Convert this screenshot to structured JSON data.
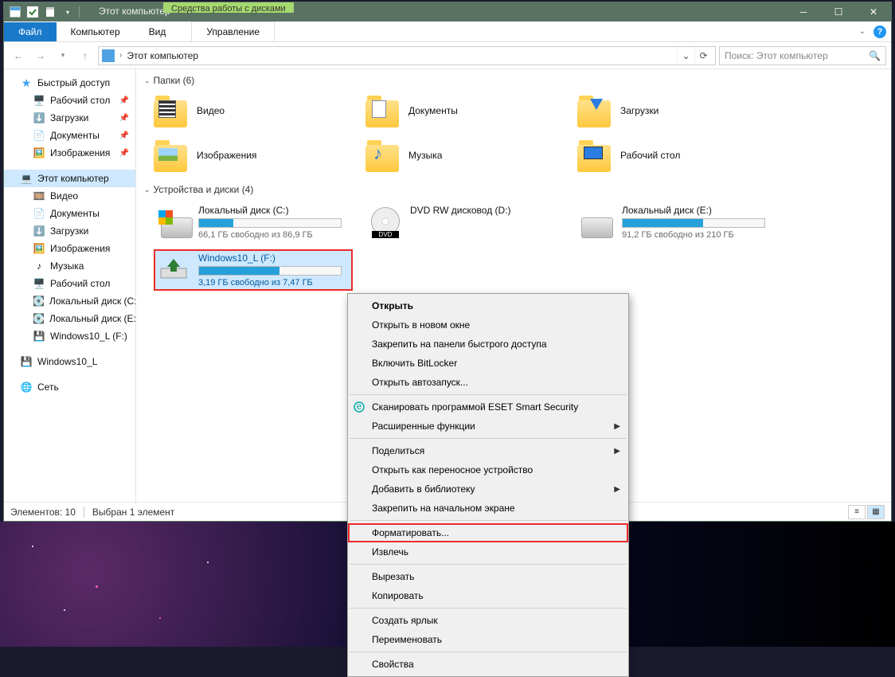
{
  "titlebar": {
    "context_label": "Средства работы с дисками",
    "context_tab": "Управление",
    "title": "Этот компьютер"
  },
  "menu": {
    "file": "Файл",
    "items": [
      "Компьютер",
      "Вид"
    ],
    "manage": "Управление"
  },
  "address": {
    "location": "Этот компьютер"
  },
  "search": {
    "placeholder": "Поиск: Этот компьютер"
  },
  "sidebar": {
    "quick_access": "Быстрый доступ",
    "quick_items": [
      {
        "label": "Рабочий стол",
        "pin": true
      },
      {
        "label": "Загрузки",
        "pin": true
      },
      {
        "label": "Документы",
        "pin": true
      },
      {
        "label": "Изображения",
        "pin": true
      }
    ],
    "this_pc": "Этот компьютер",
    "pc_items": [
      "Видео",
      "Документы",
      "Загрузки",
      "Изображения",
      "Музыка",
      "Рабочий стол",
      "Локальный диск (C:)",
      "Локальный диск (E:)",
      "Windows10_L (F:)"
    ],
    "w10l": "Windows10_L",
    "network": "Сеть"
  },
  "groups": {
    "folders": {
      "header": "Папки (6)",
      "items": [
        "Видео",
        "Документы",
        "Загрузки",
        "Изображения",
        "Музыка",
        "Рабочий стол"
      ]
    },
    "devices": {
      "header": "Устройства и диски (4)",
      "items": [
        {
          "name": "Локальный диск (C:)",
          "free": "66,1 ГБ свободно из 86,9 ГБ",
          "fill": 24,
          "icon": "win"
        },
        {
          "name": "DVD RW дисковод (D:)",
          "free": "",
          "fill": -1,
          "icon": "dvd"
        },
        {
          "name": "Локальный диск (E:)",
          "free": "91,2 ГБ свободно из 210 ГБ",
          "fill": 57,
          "icon": "hdd"
        },
        {
          "name": "Windows10_L (F:)",
          "free": "3,19 ГБ свободно из 7,47 ГБ",
          "fill": 57,
          "icon": "usb",
          "selected": true,
          "highlight": true
        }
      ]
    }
  },
  "status": {
    "count": "Элементов: 10",
    "sel": "Выбран 1 элемент"
  },
  "context_menu": [
    {
      "label": "Открыть",
      "bold": true
    },
    {
      "label": "Открыть в новом окне"
    },
    {
      "label": "Закрепить на панели быстрого доступа"
    },
    {
      "label": "Включить BitLocker"
    },
    {
      "label": "Открыть автозапуск..."
    },
    {
      "sep": true
    },
    {
      "label": "Сканировать программой ESET Smart Security",
      "icon": "eset"
    },
    {
      "label": "Расширенные функции",
      "submenu": true
    },
    {
      "sep": true
    },
    {
      "label": "Поделиться",
      "submenu": true
    },
    {
      "label": "Открыть как переносное устройство"
    },
    {
      "label": "Добавить в библиотеку",
      "submenu": true
    },
    {
      "label": "Закрепить на начальном экране"
    },
    {
      "sep": true
    },
    {
      "label": "Форматировать...",
      "highlight": true
    },
    {
      "label": "Извлечь"
    },
    {
      "sep": true
    },
    {
      "label": "Вырезать"
    },
    {
      "label": "Копировать"
    },
    {
      "sep": true
    },
    {
      "label": "Создать ярлык"
    },
    {
      "label": "Переименовать"
    },
    {
      "sep": true
    },
    {
      "label": "Свойства"
    }
  ]
}
